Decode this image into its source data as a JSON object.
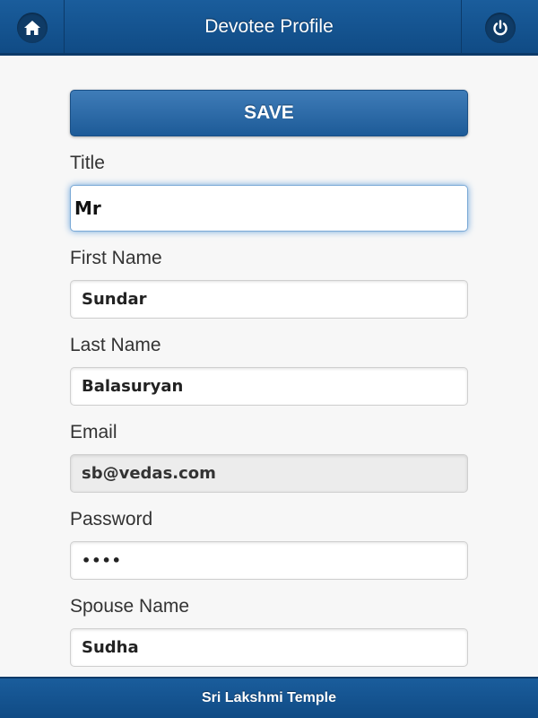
{
  "header": {
    "title": "Devotee Profile",
    "home_icon": "home-icon",
    "power_icon": "power-icon"
  },
  "form": {
    "save_label": "SAVE",
    "fields": {
      "title": {
        "label": "Title",
        "value": "Mr"
      },
      "first_name": {
        "label": "First Name",
        "value": "Sundar"
      },
      "last_name": {
        "label": "Last Name",
        "value": "Balasuryan"
      },
      "email": {
        "label": "Email",
        "value": "sb@vedas.com"
      },
      "password": {
        "label": "Password",
        "value": "••••"
      },
      "spouse_name": {
        "label": "Spouse Name",
        "value": "Sudha"
      }
    }
  },
  "footer": {
    "text": "Sri Lakshmi Temple"
  },
  "colors": {
    "header_bg": "#155493",
    "button_bg": "#2e6ba8",
    "focus_glow": "#6ea5dc",
    "disabled_bg": "#ececec"
  }
}
